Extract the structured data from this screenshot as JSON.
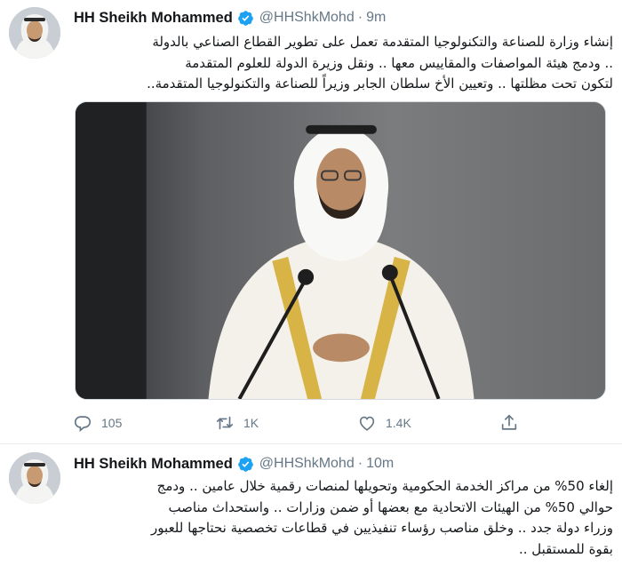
{
  "tweets": [
    {
      "author": {
        "name": "HH Sheikh Mohammed",
        "handle": "@HHShkMohd",
        "separator": "·",
        "time": "9m"
      },
      "text_lines": [
        "إنشاء وزارة للصناعة والتكنولوجيا المتقدمة تعمل على تطوير القطاع الصناعي بالدولة",
        ".. ودمج هيئة المواصفات والمقاييس معها .. ونقل وزيرة الدولة  للعلوم المتقدمة",
        "لتكون تحت مظلتها .. وتعيين الأخ سلطان الجابر وزيراً للصناعة والتكنولوجيا المتقدمة.."
      ],
      "actions": {
        "reply_count": "105",
        "retweet_count": "1K",
        "like_count": "1.4K"
      }
    },
    {
      "author": {
        "name": "HH Sheikh Mohammed",
        "handle": "@HHShkMohd",
        "separator": "·",
        "time": "10m"
      },
      "text_lines": [
        "إلغاء 50% من مراكز الخدمة الحكومية وتحويلها لمنصات رقمية خلال عامين .. ودمج",
        "حوالي 50% من الهيئات الاتحادية مع بعضها أو ضمن وزارات .. واستحداث مناصب",
        "وزراء دولة جدد .. وخلق مناصب رؤساء تنفيذيين في قطاعات تخصصية نحتاجها للعبور",
        "بقوة للمستقبل .."
      ]
    }
  ],
  "icons": {
    "verified": "verified-badge-icon",
    "reply": "reply-icon",
    "retweet": "retweet-icon",
    "like": "heart-icon",
    "share": "share-icon"
  },
  "colors": {
    "verified_blue": "#1da1f2",
    "secondary_text": "#657786",
    "divider": "#e6ecf0"
  }
}
